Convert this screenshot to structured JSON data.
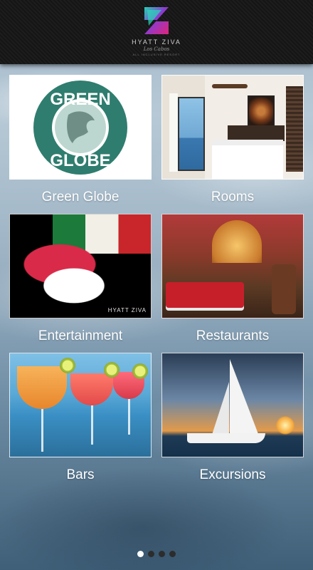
{
  "header": {
    "brand": "HYATT ZIVA",
    "brand_sub": "Los Cabos",
    "brand_tiny": "ALL INCLUSIVE RESORT"
  },
  "tiles": [
    {
      "label": "Green Globe",
      "logo_text_top": "GREEN",
      "logo_text_bottom": "GLOBE"
    },
    {
      "label": "Rooms"
    },
    {
      "label": "Entertainment",
      "watermark": "HYATT ZIVA"
    },
    {
      "label": "Restaurants"
    },
    {
      "label": "Bars"
    },
    {
      "label": "Excursions"
    }
  ],
  "pager": {
    "total": 4,
    "active": 1
  },
  "colors": {
    "header_bg": "#1a1a1a",
    "green_globe": "#2f7d6e",
    "label_text": "#ffffff"
  }
}
